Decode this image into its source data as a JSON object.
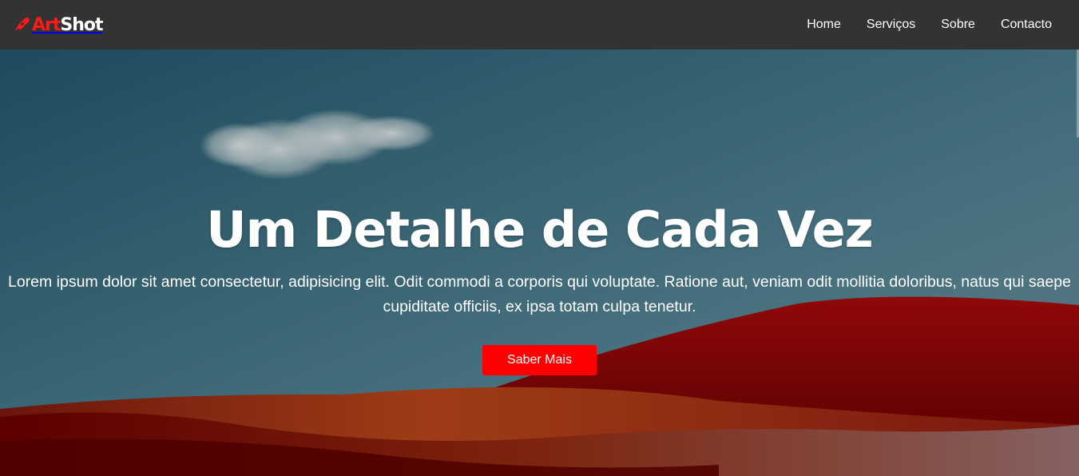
{
  "brand": {
    "part1": "Art",
    "part2": "Shot",
    "icon": "pen-nib-icon",
    "accent": "#ff1a1a"
  },
  "nav": {
    "items": [
      {
        "label": "Home"
      },
      {
        "label": "Serviços"
      },
      {
        "label": "Sobre"
      },
      {
        "label": "Contacto"
      }
    ]
  },
  "hero": {
    "title": "Um Detalhe de Cada Vez",
    "text": "Lorem ipsum dolor sit amet consectetur, adipisicing elit. Odit commodi a corporis qui voluptate. Ratione aut, veniam odit mollitia doloribus, natus qui saepe cupiditate officiis, ex ipsa totam culpa tenetur.",
    "button_label": "Saber Mais",
    "button_color": "#ff0000"
  },
  "colors": {
    "navbar": "#333333",
    "sky_top": "#2d5f72",
    "sky_bottom": "#5d8a99",
    "hills": "#8b0000"
  }
}
